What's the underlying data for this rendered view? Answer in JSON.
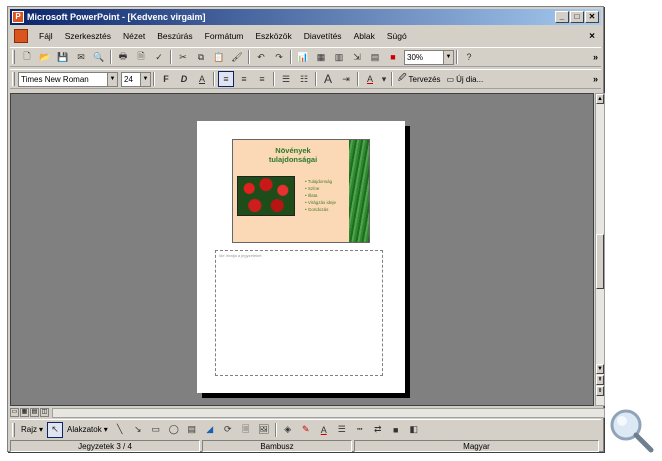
{
  "window": {
    "app_icon": "powerpoint-icon",
    "title": "Microsoft PowerPoint - [Kedvenc virgaim]",
    "buttons": [
      "_",
      "□",
      "✕"
    ]
  },
  "menu": {
    "items": [
      "Fájl",
      "Szerkesztés",
      "Nézet",
      "Beszúrás",
      "Formátum",
      "Eszközök",
      "Diavetítés",
      "Ablak",
      "Súgó"
    ],
    "close": "×"
  },
  "standard_toolbar": {
    "zoom": "30%",
    "help_icon": "?"
  },
  "formatting_toolbar": {
    "font": "Times New Roman",
    "size": "24",
    "bold": "F",
    "italic": "D",
    "underline": "A",
    "font_grow": "A",
    "font_color": "A",
    "design_label": "Tervezés",
    "new_slide_label": "Új dia..."
  },
  "slide": {
    "title": "Növények tulajdonságai",
    "bullets": [
      "Tulajdonság",
      "Színe",
      "Illata",
      "Virágzás ideje",
      "Gondozás"
    ],
    "notes_placeholder": "Ide írhatja a jegyzeteket"
  },
  "view_buttons": [
    "▭",
    "▦",
    "▤",
    "◫"
  ],
  "drawing_toolbar": {
    "draw_label": "Rajz",
    "autoshapes_label": "Alakzatok"
  },
  "status": {
    "page": "Jegyzetek 3 / 4",
    "design": "Bambusz",
    "language": "Magyar"
  }
}
